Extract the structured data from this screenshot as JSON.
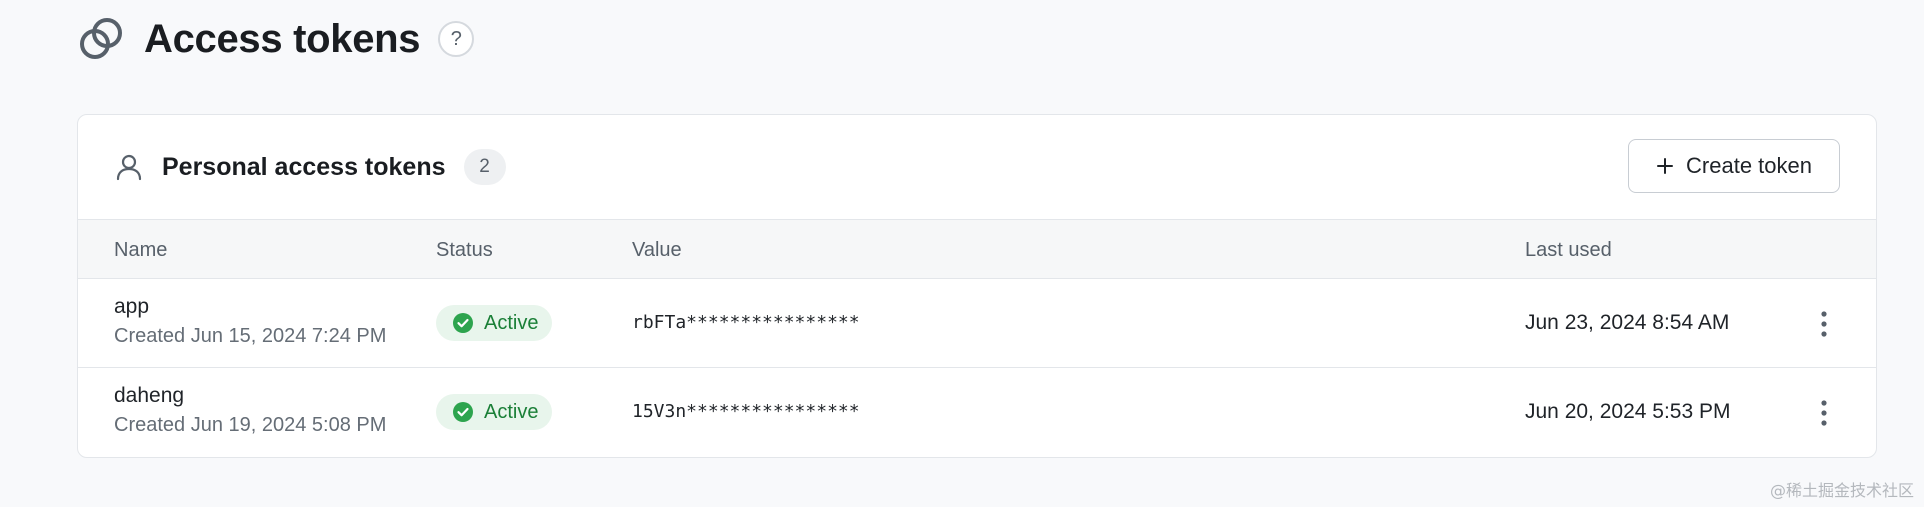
{
  "header": {
    "title": "Access tokens",
    "help_label": "?"
  },
  "card": {
    "title": "Personal access tokens",
    "count": "2",
    "create_button_label": "Create token"
  },
  "table": {
    "columns": [
      "Name",
      "Status",
      "Value",
      "Last used"
    ],
    "rows": [
      {
        "name": "app",
        "created": "Created Jun 15, 2024 7:24 PM",
        "status": "Active",
        "value": "rbFTa****************",
        "last_used": "Jun 23, 2024 8:54 AM"
      },
      {
        "name": "daheng",
        "created": "Created Jun 19, 2024 5:08 PM",
        "status": "Active",
        "value": "15V3n****************",
        "last_used": "Jun 20, 2024 5:53 PM"
      }
    ]
  },
  "watermark": "@稀土掘金技术社区",
  "icons": {
    "header": "linked-circles-icon",
    "card": "person-icon",
    "create": "plus-icon",
    "status": "check-circle-icon",
    "row_menu": "more-vertical-icon"
  },
  "colors": {
    "active_text": "#1a7f37",
    "active_bg": "#e8f5ec",
    "active_icon": "#2da44e"
  }
}
